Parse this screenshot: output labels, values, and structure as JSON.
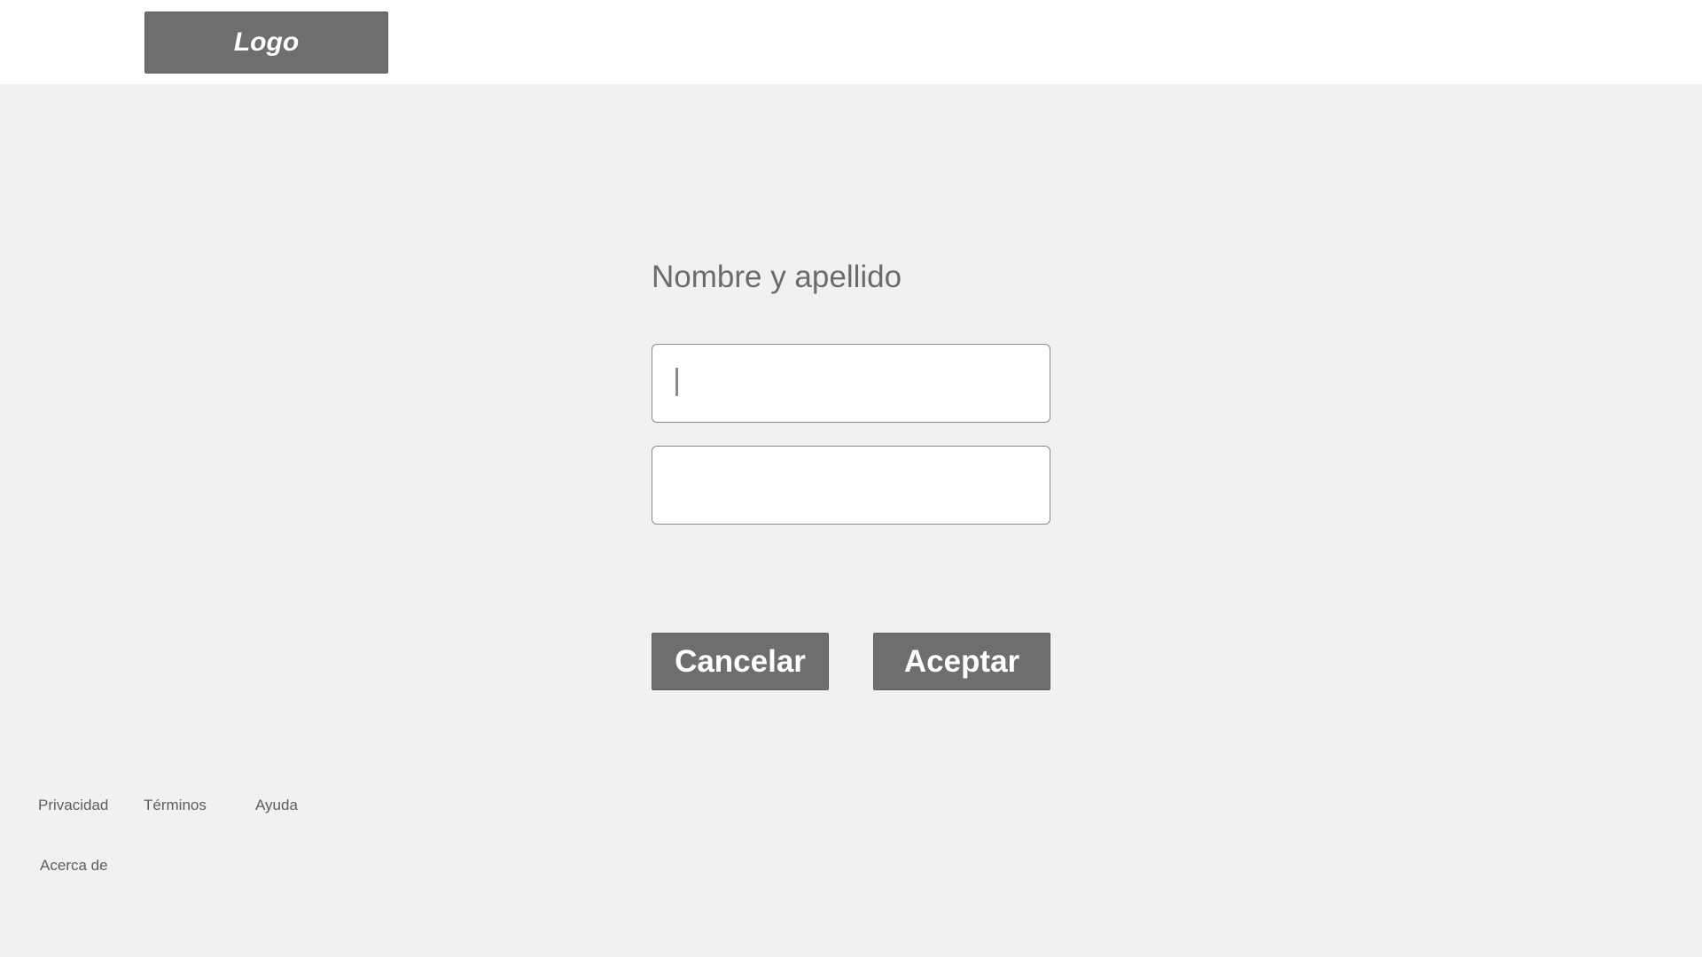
{
  "header": {
    "logo_label": "Logo"
  },
  "form": {
    "title": "Nombre y apellido",
    "fields": [
      {
        "value": "",
        "placeholder": ""
      },
      {
        "value": "",
        "placeholder": ""
      }
    ],
    "cancel_label": "Cancelar",
    "accept_label": "Aceptar"
  },
  "footer": {
    "links": [
      {
        "label": "Privacidad"
      },
      {
        "label": "Términos"
      },
      {
        "label": "Ayuda"
      },
      {
        "label": "Acerca de"
      }
    ]
  },
  "colors": {
    "header_bg": "#ffffff",
    "main_bg": "#f1f1f1",
    "button_bg": "#6e6e6e",
    "text_gray": "#6b6b6b"
  }
}
